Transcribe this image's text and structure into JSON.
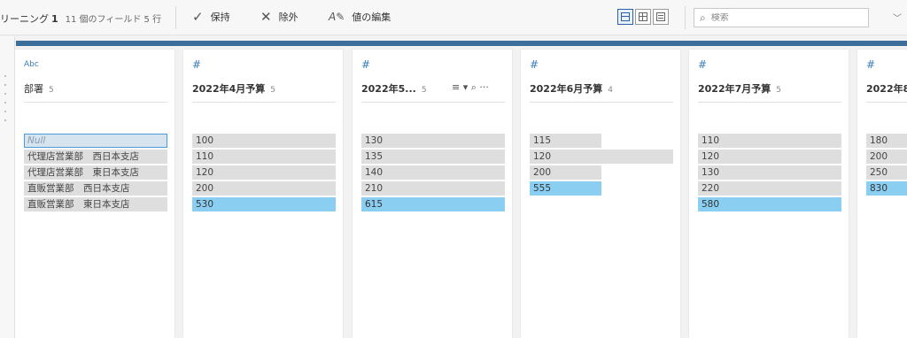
{
  "toolbar": {
    "title": "リーニング",
    "title_num": "1",
    "meta": "11 個のフィールド  5 行",
    "actions": [
      {
        "icon": "✓",
        "label": "保持"
      },
      {
        "icon": "✕",
        "label": "除外"
      },
      {
        "icon": "A✎",
        "label": "値の編集"
      }
    ],
    "search_placeholder": "検索",
    "views": [
      "profile-view",
      "data-grid-view",
      "list-view"
    ]
  },
  "columns": [
    {
      "type": "Abc",
      "name": "部署",
      "count": "5",
      "values": [
        "Null",
        "代理店営業部　西日本支店",
        "代理店営業部　東日本支店",
        "直販営業部　西日本支店",
        "直販営業部　東日本支店"
      ],
      "fills": [
        1,
        1,
        1,
        1,
        1
      ],
      "selected": -1,
      "null_index": 0
    },
    {
      "type": "#",
      "name": "2022年4月予算",
      "count": "5",
      "values": [
        "100",
        "110",
        "120",
        "200",
        "530"
      ],
      "fills": [
        1,
        1,
        1,
        1,
        1
      ],
      "selected": 4
    },
    {
      "type": "#",
      "name": "2022年5...",
      "count": "5",
      "values": [
        "130",
        "135",
        "140",
        "210",
        "615"
      ],
      "fills": [
        1,
        1,
        1,
        1,
        1
      ],
      "selected": 4,
      "tools": true
    },
    {
      "type": "#",
      "name": "2022年6月予算",
      "count": "4",
      "values": [
        "115",
        "120",
        "200",
        "555"
      ],
      "fills": [
        0.5,
        1,
        0.5,
        0.5
      ],
      "selected": 3
    },
    {
      "type": "#",
      "name": "2022年7月予算",
      "count": "5",
      "values": [
        "110",
        "120",
        "130",
        "220",
        "580"
      ],
      "fills": [
        1,
        1,
        1,
        1,
        1
      ],
      "selected": 4
    },
    {
      "type": "#",
      "name": "2022年8",
      "count": "",
      "values": [
        "180",
        "200",
        "250",
        "830"
      ],
      "fills": [
        1,
        1,
        1,
        1
      ],
      "selected": 3
    }
  ],
  "colors": {
    "accent": "#3b6e98",
    "selected": "#8acef2",
    "bar": "#dedede"
  }
}
